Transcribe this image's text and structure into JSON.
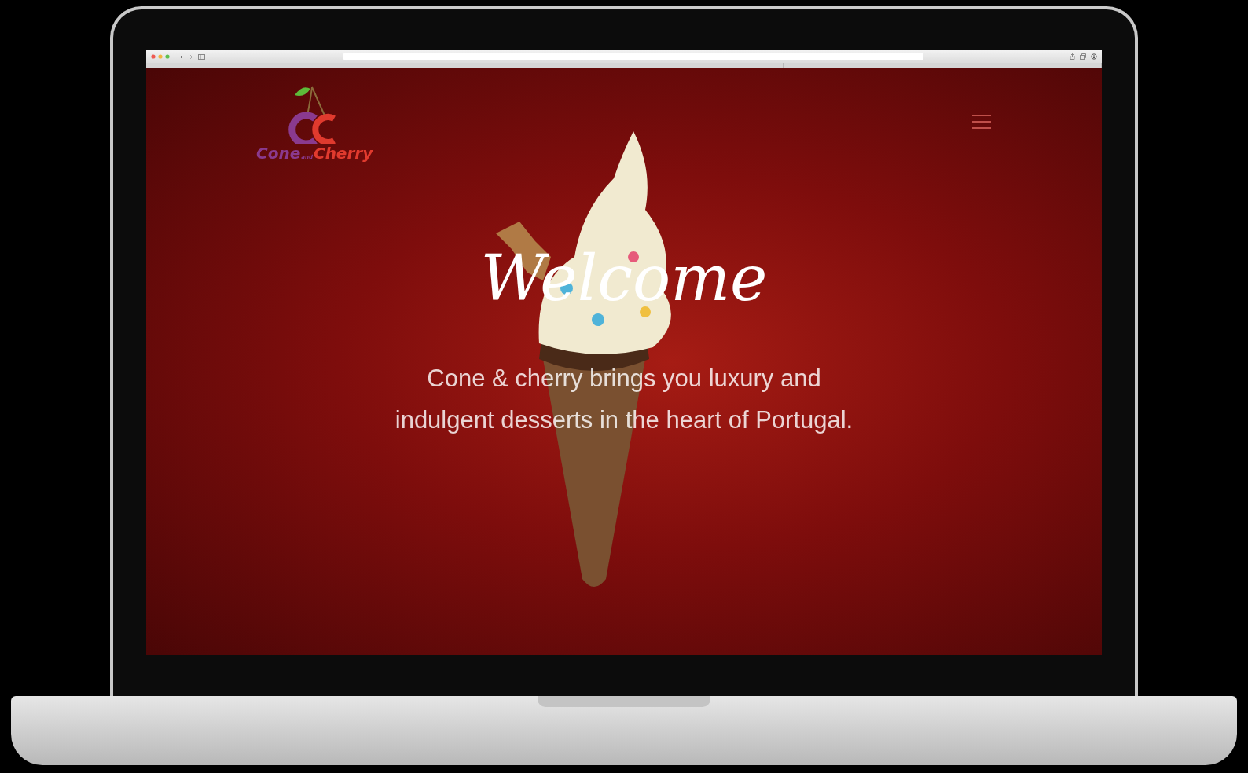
{
  "logo": {
    "word_1": "Cone",
    "word_2": "and",
    "word_3": "Cherry"
  },
  "hero": {
    "title": "Welcome",
    "text": "Cone & cherry brings you luxury and\nindulgent desserts in the heart of Portugal."
  }
}
